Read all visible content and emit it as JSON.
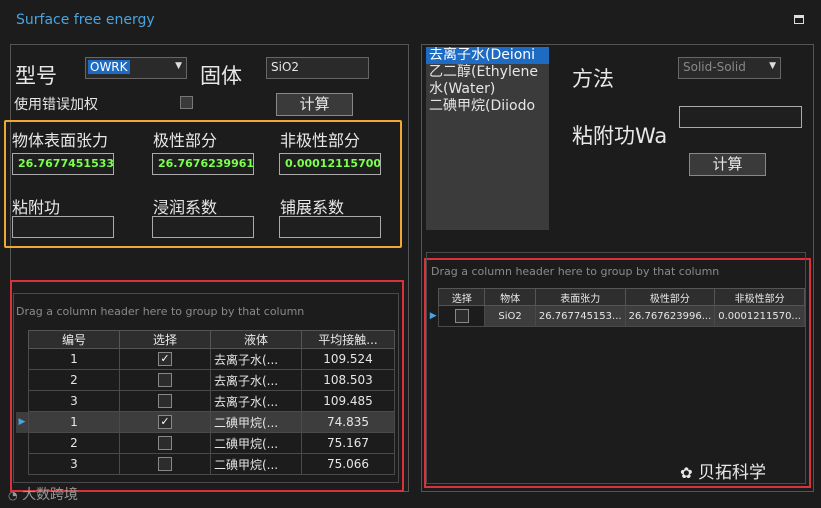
{
  "window": {
    "title": "Surface free energy"
  },
  "left": {
    "model_label": "型号",
    "model_value": "OWRK",
    "solid_label": "固体",
    "solid_value": "SiO2",
    "error_weight_label": "使用错误加权",
    "calc_button": "计算",
    "fields": {
      "surface_tension_label": "物体表面张力",
      "surface_tension_value": "26.76774515339...",
      "polar_label": "极性部分",
      "polar_value": "26.76762399611...",
      "nonpolar_label": "非极性部分",
      "nonpolar_value": "0.00012115700...",
      "adhesion_label": "粘附功",
      "adhesion_value": "",
      "wetting_label": "浸润系数",
      "wetting_value": "",
      "spreading_label": "铺展系数",
      "spreading_value": ""
    },
    "grid": {
      "hint": "Drag a column header here to group by that column",
      "columns": [
        "编号",
        "选择",
        "液体",
        "平均接触..."
      ],
      "rows": [
        {
          "no": "1",
          "checked": true,
          "liquid": "去离子水(...",
          "angle": "109.524",
          "current": false
        },
        {
          "no": "2",
          "checked": false,
          "liquid": "去离子水(...",
          "angle": "108.503",
          "current": false
        },
        {
          "no": "3",
          "checked": false,
          "liquid": "去离子水(...",
          "angle": "109.485",
          "current": false
        },
        {
          "no": "1",
          "checked": true,
          "liquid": "二碘甲烷(...",
          "angle": "74.835",
          "current": true
        },
        {
          "no": "2",
          "checked": false,
          "liquid": "二碘甲烷(...",
          "angle": "75.167",
          "current": false
        },
        {
          "no": "3",
          "checked": false,
          "liquid": "二碘甲烷(...",
          "angle": "75.066",
          "current": false
        }
      ]
    }
  },
  "right": {
    "liquids": [
      "去离子水(Deioni",
      "乙二醇(Ethylene",
      "水(Water)",
      "二碘甲烷(Diiodo"
    ],
    "method_label": "方法",
    "method_value": "Solid-Solid",
    "adhesion_label": "粘附功Wa",
    "adhesion_value": "",
    "calc_button": "计算",
    "grid": {
      "hint": "Drag a column header here to group by that column",
      "columns": [
        "选择",
        "物体",
        "表面张力",
        "极性部分",
        "非极性部分"
      ],
      "rows": [
        {
          "checked": false,
          "solid": "SiO2",
          "tension": "26.767745153...",
          "polar": "26.767623996...",
          "nonpolar": "0.0001211570..."
        }
      ]
    }
  },
  "watermarks": {
    "right": "贝拓科学",
    "left": "大数跨境"
  },
  "colors": {
    "accent_blue": "#1e6bc4",
    "title_blue": "#4aa3df",
    "value_green": "#7CFF4F",
    "highlight_orange": "#f0a830",
    "highlight_red": "#d8333a"
  }
}
